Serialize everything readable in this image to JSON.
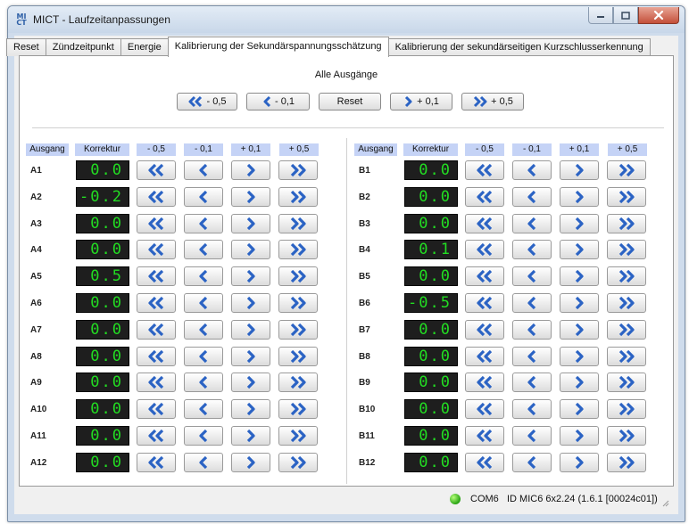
{
  "window": {
    "title": "MICT - Laufzeitanpassungen",
    "icon": "MI CT"
  },
  "tabs": [
    {
      "label": "Reset",
      "active": false
    },
    {
      "label": "Zündzeitpunkt",
      "active": false
    },
    {
      "label": "Energie",
      "active": false
    },
    {
      "label": "Kalibrierung der Sekundärspannungsschätzung",
      "active": true
    },
    {
      "label": "Kalibrierung der sekundärseitigen Kurzschlusserkennung",
      "active": false
    }
  ],
  "all_outputs": {
    "label": "Alle Ausgänge",
    "buttons": [
      {
        "label": "- 0,5",
        "icon": "double-chevron-left-icon"
      },
      {
        "label": "- 0,1",
        "icon": "chevron-left-icon"
      },
      {
        "label": "Reset",
        "icon": ""
      },
      {
        "label": "+ 0,1",
        "icon": "chevron-right-icon"
      },
      {
        "label": "+ 0,5",
        "icon": "double-chevron-right-icon"
      }
    ]
  },
  "columns": [
    "Ausgang",
    "Korrektur",
    "- 0,5",
    "- 0,1",
    "+ 0,1",
    "+ 0,5"
  ],
  "groups": [
    {
      "outputs": [
        {
          "label": "A1",
          "value": "0.0"
        },
        {
          "label": "A2",
          "value": "-0.2"
        },
        {
          "label": "A3",
          "value": "0.0"
        },
        {
          "label": "A4",
          "value": "0.0"
        },
        {
          "label": "A5",
          "value": "0.5"
        },
        {
          "label": "A6",
          "value": "0.0"
        },
        {
          "label": "A7",
          "value": "0.0"
        },
        {
          "label": "A8",
          "value": "0.0"
        },
        {
          "label": "A9",
          "value": "0.0"
        },
        {
          "label": "A10",
          "value": "0.0"
        },
        {
          "label": "A11",
          "value": "0.0"
        },
        {
          "label": "A12",
          "value": "0.0"
        }
      ]
    },
    {
      "outputs": [
        {
          "label": "B1",
          "value": "0.0"
        },
        {
          "label": "B2",
          "value": "0.0"
        },
        {
          "label": "B3",
          "value": "0.0"
        },
        {
          "label": "B4",
          "value": "0.1"
        },
        {
          "label": "B5",
          "value": "0.0"
        },
        {
          "label": "B6",
          "value": "-0.5"
        },
        {
          "label": "B7",
          "value": "0.0"
        },
        {
          "label": "B8",
          "value": "0.0"
        },
        {
          "label": "B9",
          "value": "0.0"
        },
        {
          "label": "B10",
          "value": "0.0"
        },
        {
          "label": "B11",
          "value": "0.0"
        },
        {
          "label": "B12",
          "value": "0.0"
        }
      ]
    }
  ],
  "status": {
    "port": "COM6",
    "device": "ID MIC6 6x2.24 (1.6.1 [00024c01])",
    "led_color": "#2db31a"
  },
  "colors": {
    "header_bg": "#c5d3f6",
    "lcd_bg": "#1e1e1e",
    "lcd_text": "#22dd22",
    "arrow_blue": "#2b63c4"
  }
}
